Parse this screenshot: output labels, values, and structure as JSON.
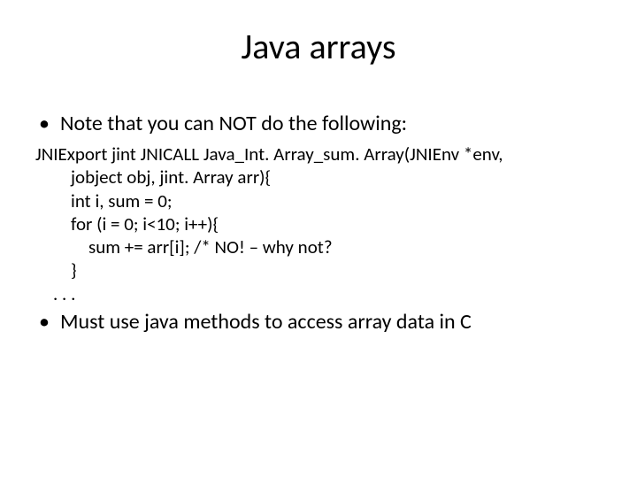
{
  "title": "Java arrays",
  "bullet1": "Note that you can NOT do the following:",
  "code": {
    "l1": "JNIExport jint JNICALL Java_Int. Array_sum. Array(JNIEnv *env,",
    "l2": "jobject obj, jint. Array arr){",
    "l3": "int i, sum = 0;",
    "l4": "for (i = 0; i<10; i++){",
    "l5": "sum += arr[i];  /* NO! – why not?",
    "l6": "}",
    "l7": ". . ."
  },
  "bullet2": "Must use java methods to access array data in C"
}
